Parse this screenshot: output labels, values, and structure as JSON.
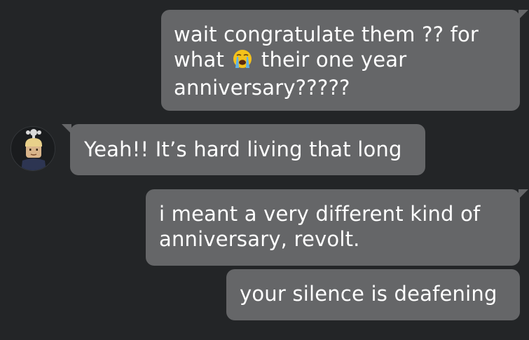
{
  "messages": [
    {
      "direction": "sent",
      "lines": [
        "wait congratulate them ?? for",
        "what",
        "their one year",
        "anniversary?????"
      ],
      "emoji": "loudly-crying-face"
    },
    {
      "direction": "received",
      "lines": [
        "Yeah!! It’s hard living that long"
      ],
      "avatar": "avatar"
    },
    {
      "direction": "sent",
      "lines": [
        "i meant a very different kind of",
        "anniversary, revolt."
      ]
    },
    {
      "direction": "sent",
      "lines": [
        "your silence is deafening"
      ]
    }
  ],
  "colors": {
    "background": "#232527",
    "bubble": "#656668",
    "text": "#ffffff"
  }
}
